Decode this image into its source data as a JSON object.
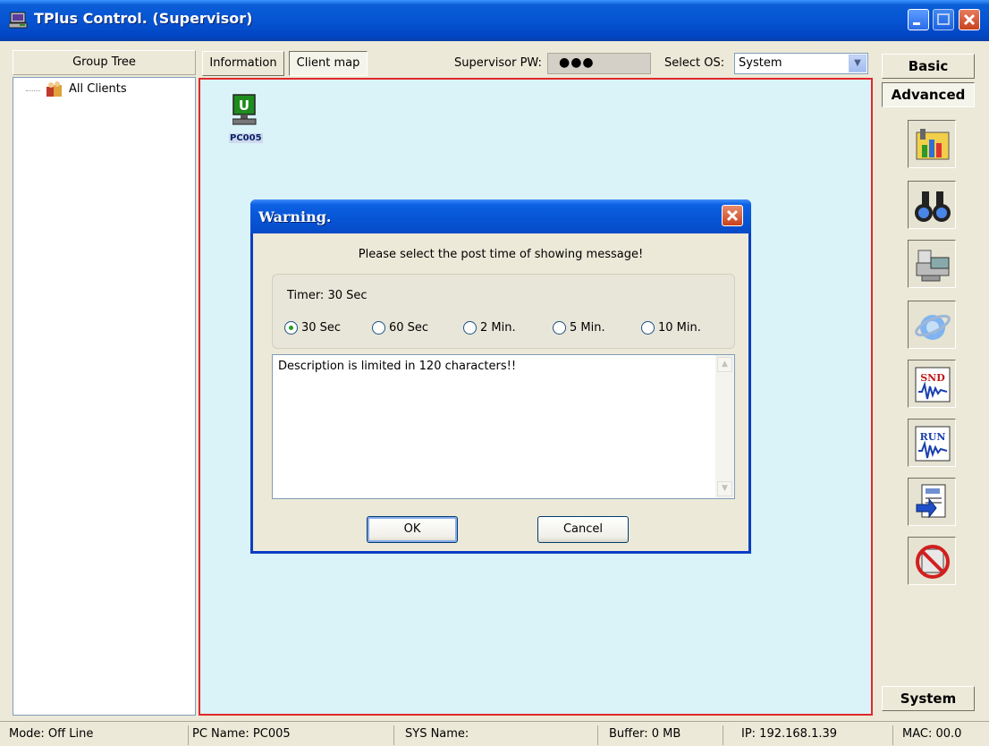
{
  "window": {
    "title": "TPlus Control. (Supervisor)",
    "title_icon": "computer-icon",
    "controls": [
      "minimize-icon",
      "maximize-icon",
      "close-icon"
    ]
  },
  "left_panel": {
    "header": "Group Tree",
    "tree_items": [
      {
        "label": "All Clients",
        "icon": "client-group-icon"
      }
    ]
  },
  "toolbar": {
    "tabs": [
      {
        "label": "Information"
      },
      {
        "label": "Client map",
        "selected": true
      }
    ],
    "supervisor_pw_label": "Supervisor PW:",
    "supervisor_pw_value": "●●●",
    "select_os_label": "Select OS:",
    "select_os_value": "System"
  },
  "client_map": {
    "nodes": [
      {
        "label": "PC005",
        "icon": "pc-icon",
        "badge": "U"
      }
    ]
  },
  "right_panel": {
    "basic_label": "Basic",
    "advanced_label": "Advanced",
    "system_label": "System",
    "tools": [
      "control-panel-icon",
      "binoculars-icon",
      "remote-control-icon",
      "internet-explorer-icon",
      "send-sound-icon",
      "run-program-icon",
      "send-file-icon",
      "block-icon"
    ]
  },
  "dialog": {
    "title": "Warning.",
    "message": "Please select the post time of showing message!",
    "timer_label": "Timer: 30 Sec",
    "options": [
      "30 Sec",
      "60 Sec",
      "2 Min.",
      "5 Min.",
      "10 Min."
    ],
    "selected_option": "30 Sec",
    "description": "Description is limited in 120 characters!!",
    "ok_label": "OK",
    "cancel_label": "Cancel"
  },
  "statusbar": {
    "mode": "Mode: Off Line",
    "pc_name": "PC Name: PC005",
    "sys_name": "SYS Name:",
    "buffer": "Buffer: 0 MB",
    "ip": "IP: 192.168.1.39",
    "mac": "MAC: 00.0"
  }
}
